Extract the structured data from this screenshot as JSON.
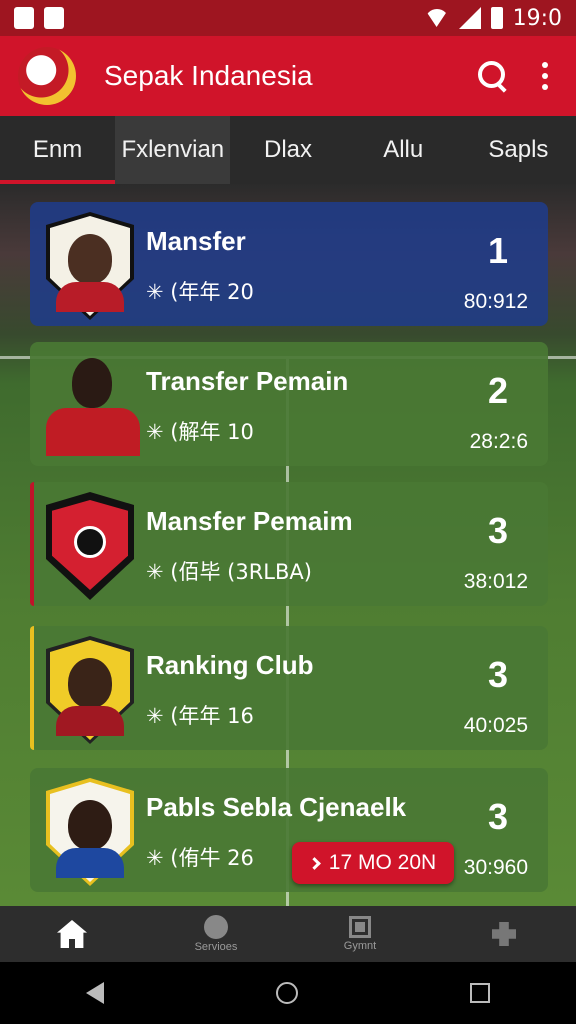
{
  "status_bar": {
    "time": "19:0"
  },
  "app_bar": {
    "title": "Sepak Indanesia",
    "search_icon": "search-icon",
    "menu_icon": "more-vert-icon"
  },
  "tabs": [
    "Enm",
    "Fxlenvian",
    "Dlax",
    "Allu",
    "Sapls"
  ],
  "cards": [
    {
      "name": "Mansfer",
      "subtitle": "✳  (年年 20",
      "rank": "1",
      "points": "80:912",
      "theme": "blue",
      "accent": "#1e3c8c"
    },
    {
      "name": "Transfer Pemain",
      "subtitle": "✳  (解年 10",
      "rank": "2",
      "points": "28:2:6",
      "theme": "green",
      "accent": ""
    },
    {
      "name": "Mansfer Pemaim",
      "subtitle": "✳  (佰毕 (3RLBA)",
      "rank": "3",
      "points": "38:012",
      "theme": "green",
      "accent": "#c0142a"
    },
    {
      "name": "Ranking Club",
      "subtitle": "✳  (年年 16",
      "rank": "3",
      "points": "40:025",
      "theme": "green",
      "accent": "#e8c020"
    },
    {
      "name": "Pabls Sebla Cjenaelk",
      "subtitle": "✳  (侑牛 26",
      "rank": "3",
      "points": "30:960",
      "theme": "green",
      "accent": ""
    }
  ],
  "action_button": {
    "label": "17 MO 20N"
  },
  "bottom_nav": [
    {
      "label": "",
      "icon": "home-icon"
    },
    {
      "label": "Servioes",
      "icon": "services-icon"
    },
    {
      "label": "Gymnt",
      "icon": "grid-icon"
    },
    {
      "label": "",
      "icon": "puzzle-icon"
    }
  ],
  "colors": {
    "primary": "#d0142a",
    "status_bar": "#9e1520",
    "tab_bar": "#2a2a2a"
  }
}
